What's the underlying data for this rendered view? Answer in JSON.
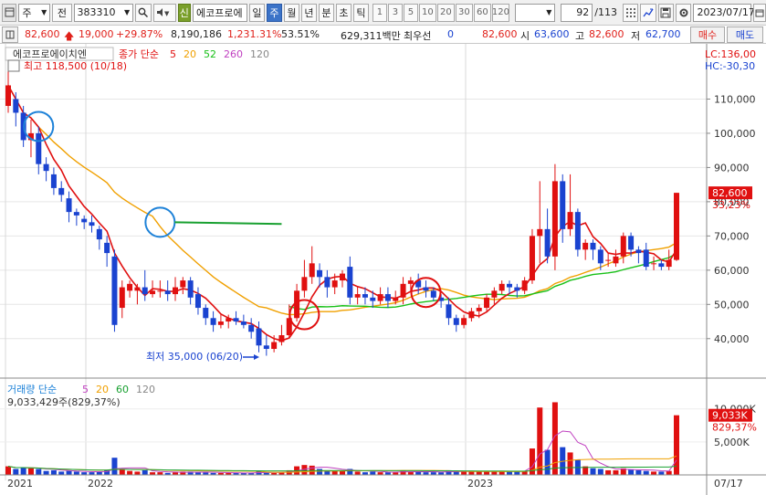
{
  "toolbar": {
    "period_label": "주",
    "prev_label": "전",
    "stock_code": "383310",
    "badge_label": "신",
    "stock_name": "에코프로에",
    "period_tabs": [
      "일",
      "주",
      "월",
      "년",
      "분",
      "초",
      "틱"
    ],
    "active_period": "주",
    "interval_buttons": [
      "1",
      "3",
      "5",
      "10",
      "20",
      "30",
      "60",
      "120"
    ],
    "page_current": "92",
    "page_total": "/113",
    "date": "2023/07/17"
  },
  "quote": {
    "price": "82,600",
    "change": "19,000",
    "change_pct": "+29.87%",
    "volume": "8,190,186",
    "volume_pct": "1,231.31%",
    "turnover_pct": "53.51%",
    "amount": "629,311백만",
    "priority_label": "최우선",
    "priority_value": "0",
    "last": "82,600",
    "open_label": "시",
    "open": "63,600",
    "high_label": "고",
    "high": "82,600",
    "low_label": "저",
    "low": "62,700",
    "buy_label": "매수",
    "sell_label": "매도"
  },
  "price_panel": {
    "stock_label": "에코프로에이치엔",
    "ma_title": "종가 단순",
    "ma_periods": [
      "5",
      "20",
      "52",
      "260",
      "120"
    ],
    "ma_colors": [
      "#e01010",
      "#f0a000",
      "#18c018",
      "#c040c0",
      "#888888"
    ],
    "high_note": "최고 118,500 (10/18)",
    "low_note": "최저 35,000 (06/20)",
    "lc": "LC:136,00",
    "hc": "HC:-30,30",
    "current_price": "82,600",
    "current_pct": "33,23%"
  },
  "volume_panel": {
    "title": "거래량 단순",
    "ma_periods": [
      "5",
      "20",
      "60",
      "120"
    ],
    "value_line": "9,033,429주(829,37%)",
    "current_value": "9,033K",
    "current_pct": "829,37%"
  },
  "axis": {
    "date_labels": [
      "2021",
      "2022",
      "2023"
    ],
    "date_end": "07/17"
  },
  "chart_data": {
    "type": "candlestick",
    "y_ticks": [
      40000,
      50000,
      60000,
      70000,
      80000,
      90000,
      100000,
      110000
    ],
    "y_range": [
      29000,
      124000
    ],
    "volume_ticks": [
      "5,000K",
      "10,000K"
    ],
    "volume_range": [
      0,
      13000
    ],
    "candles": [
      [
        108000,
        114000,
        106000,
        118500,
        1300
      ],
      [
        110000,
        106000,
        102000,
        112000,
        900
      ],
      [
        106000,
        98000,
        96000,
        108000,
        1100
      ],
      [
        98000,
        100000,
        93000,
        104000,
        1000
      ],
      [
        100000,
        91000,
        88000,
        102000,
        900
      ],
      [
        91000,
        89000,
        86000,
        93000,
        600
      ],
      [
        88000,
        84000,
        82000,
        90000,
        700
      ],
      [
        84000,
        82000,
        80000,
        86000,
        500
      ],
      [
        81000,
        77000,
        74000,
        83000,
        600
      ],
      [
        77000,
        76000,
        73000,
        78000,
        500
      ],
      [
        75000,
        74000,
        72000,
        76000,
        400
      ],
      [
        74000,
        73000,
        71000,
        76000,
        400
      ],
      [
        72000,
        69000,
        66000,
        73000,
        500
      ],
      [
        68000,
        65000,
        61000,
        70000,
        700
      ],
      [
        64000,
        44000,
        42000,
        66000,
        2600
      ],
      [
        49000,
        55000,
        46000,
        57000,
        900
      ],
      [
        54000,
        56000,
        52000,
        57000,
        600
      ],
      [
        54000,
        55000,
        50000,
        56000,
        500
      ],
      [
        55000,
        53000,
        51000,
        60000,
        700
      ],
      [
        53000,
        54000,
        52000,
        57000,
        400
      ],
      [
        54000,
        54000,
        52000,
        57000,
        400
      ],
      [
        54000,
        53000,
        51000,
        57000,
        300
      ],
      [
        53000,
        55000,
        51000,
        58000,
        400
      ],
      [
        55000,
        57000,
        53000,
        58000,
        500
      ],
      [
        57000,
        52000,
        50000,
        58000,
        500
      ],
      [
        53000,
        49000,
        47000,
        55000,
        400
      ],
      [
        49000,
        46000,
        44000,
        50000,
        400
      ],
      [
        46000,
        44000,
        42000,
        48000,
        300
      ],
      [
        44000,
        45000,
        43000,
        47000,
        300
      ],
      [
        45000,
        46000,
        43000,
        47000,
        300
      ],
      [
        46000,
        45000,
        44000,
        48000,
        300
      ],
      [
        45000,
        44000,
        43000,
        47000,
        300
      ],
      [
        44000,
        42000,
        40000,
        46000,
        300
      ],
      [
        43000,
        38000,
        36000,
        45000,
        500
      ],
      [
        38000,
        37000,
        35000,
        41000,
        400
      ],
      [
        37000,
        39000,
        36000,
        41000,
        300
      ],
      [
        39000,
        41000,
        38000,
        44000,
        400
      ],
      [
        41000,
        46000,
        40000,
        50000,
        700
      ],
      [
        46000,
        54000,
        45000,
        56000,
        1300
      ],
      [
        54000,
        58000,
        52000,
        63000,
        1500
      ],
      [
        58000,
        62000,
        56000,
        67000,
        1400
      ],
      [
        60000,
        58000,
        55000,
        62000,
        900
      ],
      [
        58000,
        55000,
        52000,
        60000,
        700
      ],
      [
        55000,
        57000,
        53000,
        59000,
        600
      ],
      [
        57000,
        59000,
        55000,
        60000,
        600
      ],
      [
        61000,
        52000,
        50000,
        64000,
        900
      ],
      [
        52000,
        53000,
        50000,
        55000,
        500
      ],
      [
        53000,
        52000,
        50000,
        55000,
        400
      ],
      [
        52000,
        51000,
        49000,
        54000,
        500
      ],
      [
        51000,
        53000,
        50000,
        55000,
        400
      ],
      [
        53000,
        51000,
        49000,
        55000,
        400
      ],
      [
        51000,
        52000,
        50000,
        54000,
        400
      ],
      [
        52000,
        56000,
        50000,
        58000,
        600
      ],
      [
        56000,
        57000,
        54000,
        58000,
        500
      ],
      [
        57000,
        55000,
        53000,
        59000,
        500
      ],
      [
        55000,
        54000,
        52000,
        57000,
        400
      ],
      [
        54000,
        52000,
        51000,
        55000,
        400
      ],
      [
        52000,
        51000,
        49000,
        53000,
        400
      ],
      [
        50000,
        46000,
        44000,
        52000,
        700
      ],
      [
        46000,
        44000,
        42000,
        47000,
        600
      ],
      [
        44000,
        46000,
        43000,
        47000,
        500
      ],
      [
        46000,
        48000,
        45000,
        49000,
        500
      ],
      [
        48000,
        49000,
        46000,
        50000,
        500
      ],
      [
        49000,
        52000,
        48000,
        53000,
        600
      ],
      [
        52000,
        54000,
        50000,
        55000,
        600
      ],
      [
        54000,
        56000,
        53000,
        57000,
        600
      ],
      [
        56000,
        55000,
        53000,
        57000,
        500
      ],
      [
        55000,
        54000,
        52000,
        56000,
        500
      ],
      [
        54000,
        57000,
        53000,
        58000,
        600
      ],
      [
        57000,
        70000,
        56000,
        72000,
        4000
      ],
      [
        70000,
        72000,
        62000,
        86000,
        10200
      ],
      [
        72000,
        64000,
        62000,
        78000,
        3800
      ],
      [
        64000,
        86000,
        60000,
        91000,
        11000
      ],
      [
        86000,
        72000,
        68000,
        88000,
        4200
      ],
      [
        72000,
        77000,
        70000,
        88000,
        3400
      ],
      [
        77000,
        66000,
        64000,
        78000,
        2300
      ],
      [
        66000,
        68000,
        63000,
        69000,
        1300
      ],
      [
        68000,
        66000,
        63000,
        69000,
        1000
      ],
      [
        66000,
        62000,
        60000,
        67000,
        900
      ],
      [
        63000,
        63000,
        61000,
        65000,
        700
      ],
      [
        62000,
        64000,
        61000,
        66000,
        700
      ],
      [
        64000,
        70000,
        62000,
        71000,
        1000
      ],
      [
        70000,
        66000,
        64000,
        71000,
        800
      ],
      [
        66000,
        65000,
        62000,
        67000,
        700
      ],
      [
        66000,
        61000,
        60000,
        68000,
        600
      ],
      [
        62000,
        62000,
        60000,
        64000,
        500
      ],
      [
        62000,
        61000,
        60000,
        63000,
        500
      ],
      [
        61000,
        63000,
        60000,
        66000,
        600
      ],
      [
        63000,
        82600,
        62700,
        82600,
        9033
      ]
    ],
    "line_52_start_index": 19,
    "annotations": [
      {
        "type": "circle",
        "color": "#1e82d8",
        "at_index": 4,
        "price": 102000
      },
      {
        "type": "circle",
        "color": "#1e82d8",
        "at_index": 20,
        "price": 74000
      },
      {
        "type": "line",
        "color": "#18a030",
        "from_index": 20,
        "from_price": 74000,
        "to_index": 36,
        "to_price": 73500
      },
      {
        "type": "circle",
        "color": "#e01010",
        "at_index": 39,
        "price": 47000
      },
      {
        "type": "circle",
        "color": "#e01010",
        "at_index": 55,
        "price": 53500
      }
    ]
  }
}
